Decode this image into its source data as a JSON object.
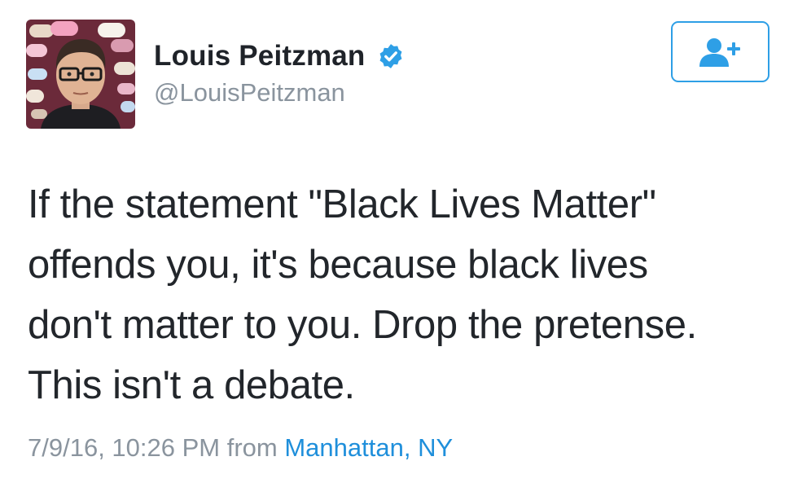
{
  "user": {
    "display_name": "Louis Peitzman",
    "handle": "@LouisPeitzman",
    "verified": true,
    "avatar_icon": "profile-photo"
  },
  "follow_button": {
    "icon": "add-user-icon"
  },
  "tweet": {
    "text": "If the statement \"Black Lives Matter\"\noffends you, it's because black lives\ndon't matter to you. Drop the pretense.\nThis isn't a debate.",
    "timestamp": "7/9/16, 10:26 PM",
    "from_word": "from",
    "location": "Manhattan, NY"
  },
  "colors": {
    "accent": "#2e9fe6",
    "link": "#1f8fdb",
    "muted": "#8a949e",
    "text": "#22262b"
  }
}
